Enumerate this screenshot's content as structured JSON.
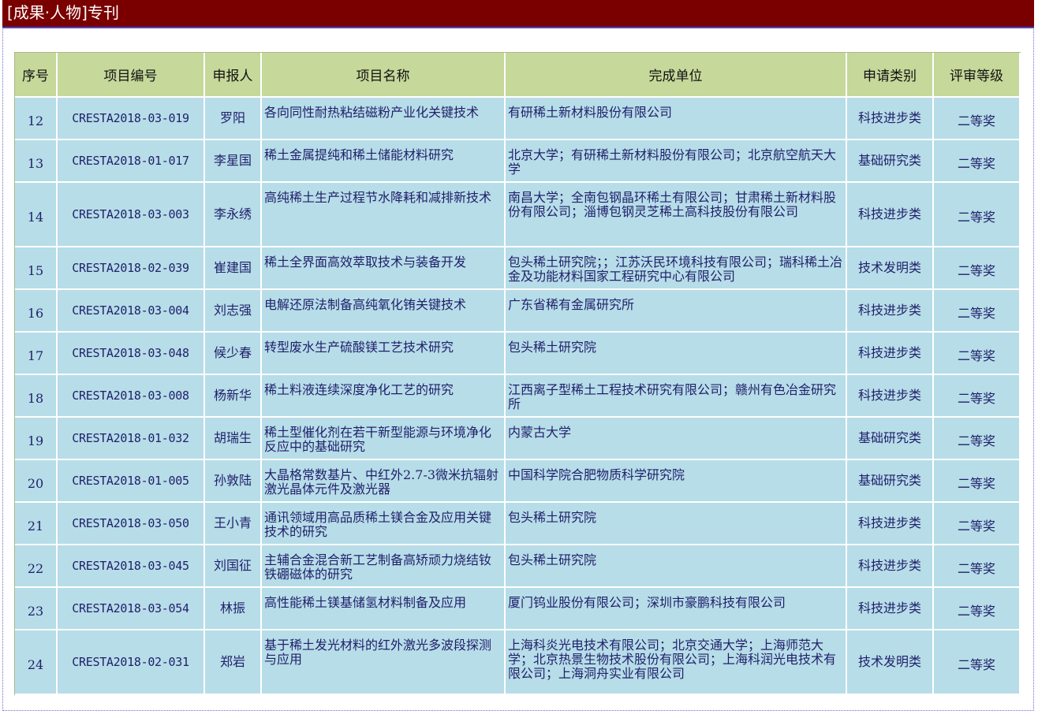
{
  "header": {
    "title": "[成果·人物]专刊"
  },
  "table": {
    "columns": [
      "序号",
      "项目编号",
      "申报人",
      "项目名称",
      "完成单位",
      "申请类别",
      "评审等级"
    ],
    "rows": [
      [
        "12",
        "CRESTA2018-03-019",
        "罗阳",
        "各向同性耐热粘结磁粉产业化关键技术",
        "有研稀土新材料股份有限公司",
        "科技进步类",
        "二等奖"
      ],
      [
        "13",
        "CRESTA2018-01-017",
        "李星国",
        "稀土金属提纯和稀土储能材料研究",
        "北京大学；有研稀土新材料股份有限公司；北京航空航天大学",
        "基础研究类",
        "二等奖"
      ],
      [
        "14",
        "CRESTA2018-03-003",
        "李永绣",
        "高纯稀土生产过程节水降耗和减排新技术",
        "南昌大学；全南包钢晶环稀土有限公司；甘肃稀土新材料股份有限公司；淄博包钢灵芝稀土高科技股份有限公司",
        "科技进步类",
        "二等奖"
      ],
      [
        "15",
        "CRESTA2018-02-039",
        "崔建国",
        "稀土全界面高效萃取技术与装备开发",
        "包头稀土研究院；；江苏沃民环境科技有限公司；瑞科稀土冶金及功能材料国家工程研究中心有限公司",
        "技术发明类",
        "二等奖"
      ],
      [
        "16",
        "CRESTA2018-03-004",
        "刘志强",
        "电解还原法制备高纯氧化铕关键技术",
        "广东省稀有金属研究所",
        "科技进步类",
        "二等奖"
      ],
      [
        "17",
        "CRESTA2018-03-048",
        "候少春",
        "转型废水生产硫酸镁工艺技术研究",
        "包头稀土研究院",
        "科技进步类",
        "二等奖"
      ],
      [
        "18",
        "CRESTA2018-03-008",
        "杨新华",
        "稀土料液连续深度净化工艺的研究",
        "江西离子型稀土工程技术研究有限公司；赣州有色冶金研究所",
        "科技进步类",
        "二等奖"
      ],
      [
        "19",
        "CRESTA2018-01-032",
        "胡瑞生",
        "稀土型催化剂在若干新型能源与环境净化反应中的基础研究",
        "内蒙古大学",
        "基础研究类",
        "二等奖"
      ],
      [
        "20",
        "CRESTA2018-01-005",
        "孙敦陆",
        "大晶格常数基片、中红外2.7-3微米抗辐射激光晶体元件及激光器",
        "中国科学院合肥物质科学研究院",
        "基础研究类",
        "二等奖"
      ],
      [
        "21",
        "CRESTA2018-03-050",
        "王小青",
        "通讯领域用高品质稀土镁合金及应用关键技术的研究",
        "包头稀土研究院",
        "科技进步类",
        "二等奖"
      ],
      [
        "22",
        "CRESTA2018-03-045",
        "刘国征",
        "主辅合金混合新工艺制备高矫顽力烧结钕铁硼磁体的研究",
        "包头稀土研究院",
        "科技进步类",
        "二等奖"
      ],
      [
        "23",
        "CRESTA2018-03-054",
        "林振",
        "高性能稀土镁基储氢材料制备及应用",
        "厦门钨业股份有限公司；深圳市豪鹏科技有限公司",
        "科技进步类",
        "二等奖"
      ],
      [
        "24",
        "CRESTA2018-02-031",
        "郑岩",
        "基于稀土发光材料的红外激光多波段探测与应用",
        "上海科炎光电技术有限公司；北京交通大学；上海师范大学；北京热景生物技术股份有限公司；上海科润光电技术有限公司；上海洞舟实业有限公司",
        "技术发明类",
        "二等奖"
      ]
    ]
  }
}
